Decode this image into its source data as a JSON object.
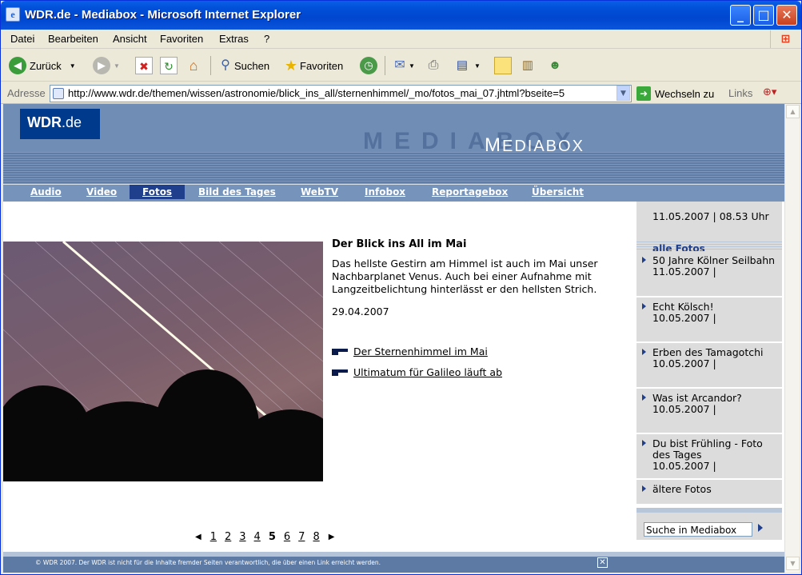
{
  "window": {
    "title": "WDR.de - Mediabox - Microsoft Internet Explorer"
  },
  "menu": [
    "Datei",
    "Bearbeiten",
    "Ansicht",
    "Favoriten",
    "Extras",
    "?"
  ],
  "toolbar": {
    "back_label": "Zurück",
    "search_label": "Suchen",
    "favorites_label": "Favoriten"
  },
  "addressbar": {
    "label": "Adresse",
    "url": "http://www.wdr.de/themen/wissen/astronomie/blick_ins_all/sternenhimmel/_mo/fotos_mai_07.jhtml?bseite=5",
    "go_label": "Wechseln zu",
    "links_label": "Links"
  },
  "site": {
    "logo_main": "WDR",
    "logo_suffix": ".de",
    "section_ghost": "MEDIABOX",
    "section_first": "M",
    "section_rest": "EDIABOX"
  },
  "nav": [
    "Audio",
    "Video",
    "Fotos",
    "Bild des Tages",
    "WebTV",
    "Infobox",
    "Reportagebox",
    "Übersicht"
  ],
  "article": {
    "title": "Der Blick ins All im Mai",
    "text": "Das hellste Gestirn am Himmel ist auch im Mai unser Nachbarplanet Venus. Auch bei einer Aufnahme mit Langzeitbelichtung hinterlässt er den hellsten Strich.",
    "date": "29.04.2007",
    "links": [
      "Der Sternenhimmel im Mai",
      "Ultimatum für Galileo läuft ab"
    ]
  },
  "pagination": {
    "pages": [
      "1",
      "2",
      "3",
      "4",
      "5",
      "6",
      "7",
      "8"
    ],
    "current": "5"
  },
  "sidebar": {
    "datetime": "11.05.2007 | 08.53 Uhr",
    "heading": "alle Fotos",
    "items": [
      {
        "title": "50 Jahre Kölner Seilbahn",
        "date": "11.05.2007 |"
      },
      {
        "title": "Echt Kölsch!",
        "date": "10.05.2007 |"
      },
      {
        "title": "Erben des Tamagotchi",
        "date": "10.05.2007 |"
      },
      {
        "title": "Was ist Arcandor?",
        "date": "10.05.2007 |"
      },
      {
        "title": "Du bist Frühling - Foto des Tages",
        "date": "10.05.2007 |"
      },
      {
        "title": "ältere Fotos",
        "date": ""
      }
    ],
    "search_value": "Suche in Mediabox"
  },
  "footer": {
    "text": "© WDR 2007. Der WDR ist nicht für die Inhalte fremder Seiten verantwortlich, die über einen Link erreicht werden."
  },
  "icons": {
    "back": "back-arrow-icon",
    "forward": "forward-arrow-icon",
    "stop": "stop-icon",
    "refresh": "refresh-icon",
    "home": "home-icon",
    "search": "search-icon",
    "favorites": "star-icon",
    "history": "history-icon",
    "mail": "mail-icon",
    "print": "printer-icon",
    "edit": "edit-icon",
    "discuss": "discuss-icon",
    "research": "research-icon",
    "messenger": "messenger-icon"
  },
  "colors": {
    "titlebar": "#0054e3",
    "header_blue": "#6f8db5",
    "logo_blue": "#003a8c",
    "nav_active": "#1f3f8c",
    "sidebar_bg": "#dcdcdc"
  }
}
